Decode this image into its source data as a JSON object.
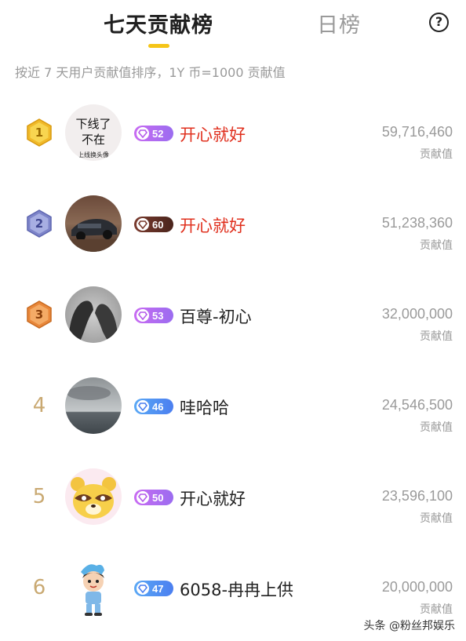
{
  "header": {
    "tab_active": "七天贡献榜",
    "tab_inactive": "日榜",
    "help": "?"
  },
  "subtitle": "按近 7 天用户贡献值排序，1Y 币=1000 贡献值",
  "colors": {
    "accent_yellow": "#f5c518",
    "name_red": "#e0301e",
    "name_dark": "#222222",
    "gray_text": "#9a9a9a",
    "rank_gold": "#c9a972"
  },
  "rows": [
    {
      "rank": "1",
      "badge": "gold-hexagon",
      "level": "52",
      "level_style": "purple",
      "name": "开心就好",
      "name_color": "red",
      "value": "59,716,460",
      "value_label": "贡献值",
      "avatar": {
        "type": "text",
        "line1": "下线了",
        "line2": "不在",
        "line3": "上线换头像"
      }
    },
    {
      "rank": "2",
      "badge": "silver-hexagon",
      "level": "60",
      "level_style": "brown",
      "name": "开心就好",
      "name_color": "red",
      "value": "51,238,360",
      "value_label": "贡献值",
      "avatar": {
        "type": "car-photo"
      }
    },
    {
      "rank": "3",
      "badge": "bronze-hexagon",
      "level": "53",
      "level_style": "purple",
      "name": "百尊-初心",
      "name_color": "dark",
      "value": "32,000,000",
      "value_label": "贡献值",
      "avatar": {
        "type": "bw-photo"
      }
    },
    {
      "rank": "4",
      "badge": "number",
      "level": "46",
      "level_style": "blue",
      "name": "哇哈哈",
      "name_color": "dark",
      "value": "24,546,500",
      "value_label": "贡献值",
      "avatar": {
        "type": "sea-photo"
      }
    },
    {
      "rank": "5",
      "badge": "number",
      "level": "50",
      "level_style": "purple",
      "name": "开心就好",
      "name_color": "dark",
      "value": "23,596,100",
      "value_label": "贡献值",
      "avatar": {
        "type": "raccoon-cartoon"
      }
    },
    {
      "rank": "6",
      "badge": "number",
      "level": "47",
      "level_style": "blue",
      "name": "6058-冉冉上供",
      "name_color": "dark",
      "value": "20,000,000",
      "value_label": "贡献值",
      "avatar": {
        "type": "cartoon-boy"
      }
    }
  ],
  "watermark": "头条 @粉丝邦娱乐"
}
